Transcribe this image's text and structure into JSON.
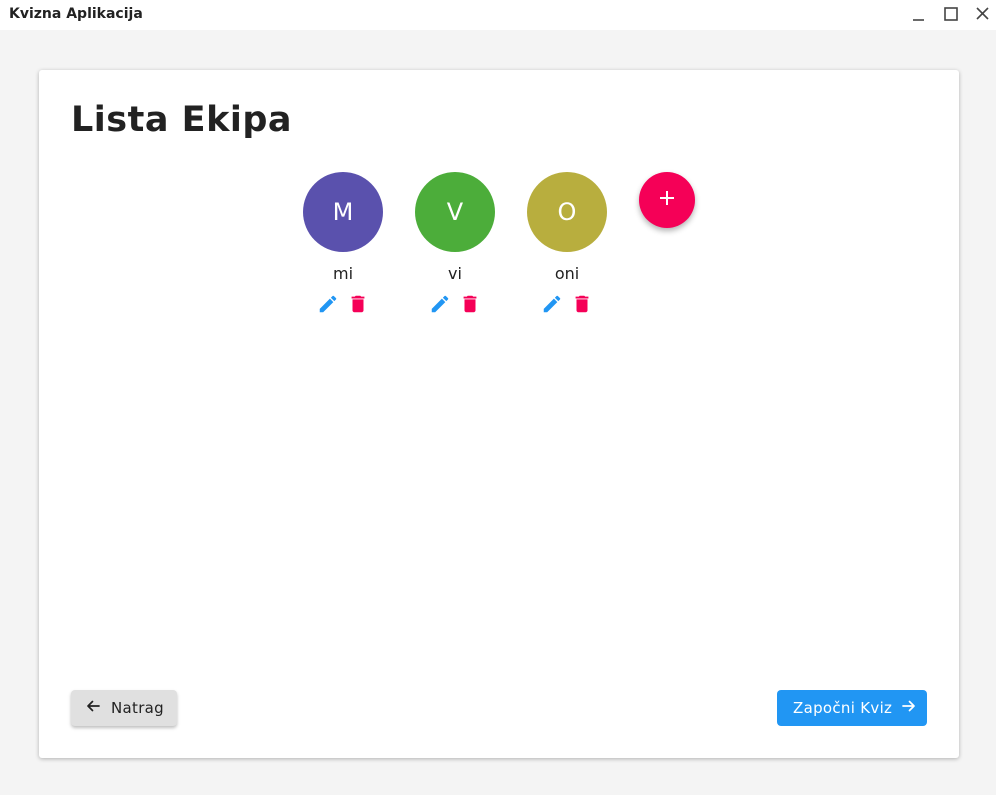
{
  "window": {
    "title": "Kvizna Aplikacija",
    "controls": [
      "minimize-icon",
      "maximize-icon",
      "close-icon"
    ]
  },
  "page": {
    "title": "Lista Ekipa"
  },
  "teams": [
    {
      "initial": "M",
      "name": "mi",
      "color": "#5a51ad"
    },
    {
      "initial": "V",
      "name": "vi",
      "color": "#4cad3a"
    },
    {
      "initial": "O",
      "name": "oni",
      "color": "#b8ae3e"
    }
  ],
  "actions": {
    "edit_icon": "pencil-icon",
    "delete_icon": "trash-icon",
    "edit_color": "#2196f3",
    "delete_color": "#f50057",
    "add_icon": "plus-icon",
    "add_color": "#f50057"
  },
  "footer": {
    "back_label": "Natrag",
    "start_label": "Započni Kviz",
    "back_icon": "arrow-left-icon",
    "start_icon": "arrow-right-icon"
  }
}
